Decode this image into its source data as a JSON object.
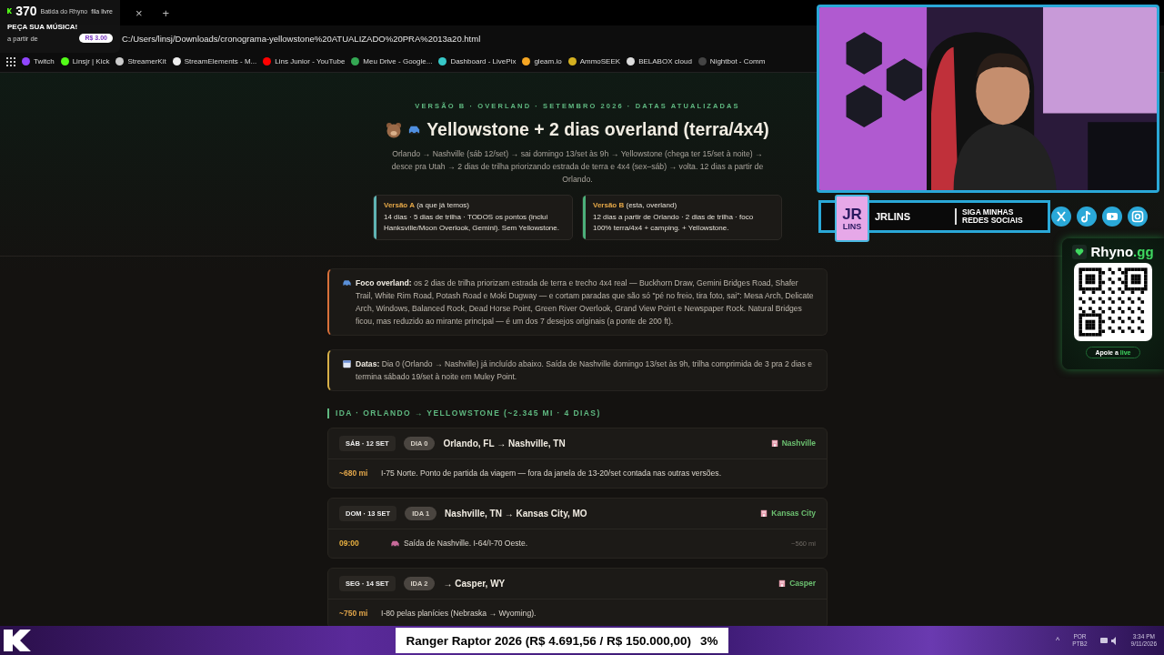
{
  "stream_overlay": {
    "viewer_count": "370",
    "request_widget": {
      "channel": "Batida do Rhyno",
      "tag": "fila livre",
      "title": "PEÇA SUA MÚSICA!",
      "price_label": "a partir de",
      "price": "R$ 3.00"
    }
  },
  "browser": {
    "tab_close": "×",
    "new_tab": "+",
    "url": "C:/Users/linsj/Downloads/cronograma-yellowstone%20ATUALIZADO%20PRA%2013a20.html",
    "bookmarks": [
      {
        "label": "Twitch",
        "color": "#9146ff"
      },
      {
        "label": "Linsjr | Kick",
        "color": "#53fc18"
      },
      {
        "label": "StreamerKit",
        "color": "#cccccc"
      },
      {
        "label": "StreamElements - M...",
        "color": "#eeeeee"
      },
      {
        "label": "Lins Junior - YouTube",
        "color": "#ff0000"
      },
      {
        "label": "Meu Drive - Google...",
        "color": "#34a853"
      },
      {
        "label": "Dashboard - LivePix",
        "color": "#37c8c8"
      },
      {
        "label": "gleam.io",
        "color": "#f5a623"
      },
      {
        "label": "AmmoSEEK",
        "color": "#d4b020"
      },
      {
        "label": "BELABOX cloud",
        "color": "#dddddd"
      },
      {
        "label": "Nightbot - Comm",
        "color": "#444444"
      }
    ]
  },
  "page": {
    "kicker": "VERSÃO B · OVERLAND · SETEMBRO 2026 · DATAS ATUALIZADAS",
    "title": "Yellowstone + 2 dias overland (terra/4x4)",
    "subtitle": "Orlando → Nashville (sáb 12/set) → sai domingo 13/set às 9h → Yellowstone (chega ter 15/set à noite) → desce pra Utah → 2 dias de trilha priorizando estrada de terra e 4x4 (sex–sáb) → volta. 12 dias a partir de Orlando.",
    "versions": [
      {
        "name": "Versão A",
        "note": "(a que já temos)",
        "description": "14 dias · 5 dias de trilha · TODOS os pontos (inclui Hanksville/Moon Overlook, Gemini). Sem Yellowstone.",
        "color": "#5fb3b3"
      },
      {
        "name": "Versão B",
        "note": "(esta, overland)",
        "description": "12 dias a partir de Orlando · 2 dias de trilha · foco 100% terra/4x4 + camping. + Yellowstone.",
        "color": "#4caf7a"
      }
    ],
    "callouts": [
      {
        "kind": "focus",
        "text": "**Foco overland:** os 2 dias de trilha priorizam estrada de terra e trecho 4x4 real — Buckhorn Draw, Gemini Bridges Road, Shafer Trail, White Rim Road, Potash Road e Moki Dugway — e cortam paradas que são só \"pé no freio, tira foto, sai\": Mesa Arch, Delicate Arch, Windows, Balanced Rock, Dead Horse Point, Green River Overlook, Grand View Point e Newspaper Rock. Natural Bridges ficou, mas reduzido ao mirante principal — é um dos 7 desejos originais (a ponte de 200 ft)."
      },
      {
        "kind": "dates",
        "text": "**Datas:** Dia 0 (Orlando → Nashville) já incluído abaixo. Saída de Nashville domingo 13/set às 9h, trilha comprimida de 3 pra 2 dias e termina sábado 19/set à noite em Muley Point."
      }
    ],
    "section_title": "IDA · ORLANDO → YELLOWSTONE (~2.345 MI · 4 DIAS)",
    "days": [
      {
        "date": "SÁB · 12 SET",
        "badge": "DIA 0",
        "route": "Orlando, FL → Nashville, TN",
        "lodging": "Nashville",
        "entries": [
          {
            "kind": "distance",
            "lead": "~680 mi",
            "icon": false,
            "text": "I-75 Norte. Ponto de partida da viagem — fora da janela de 13-20/set contada nas outras versões."
          }
        ]
      },
      {
        "date": "DOM · 13 SET",
        "badge": "IDA 1",
        "route": "Nashville, TN → Kansas City, MO",
        "lodging": "Kansas City",
        "entries": [
          {
            "kind": "time",
            "lead": "09:00",
            "icon": true,
            "text": "Saída de Nashville. I-64/I-70 Oeste.",
            "distance": "~560 mi"
          }
        ]
      },
      {
        "date": "SEG · 14 SET",
        "badge": "IDA 2",
        "route": "→ Casper, WY",
        "lodging": "Casper",
        "entries": [
          {
            "kind": "distance",
            "lead": "~750 mi",
            "icon": false,
            "text": "I-80 pelas planícies (Nebraska → Wyoming)."
          }
        ]
      }
    ]
  },
  "social_banner": {
    "logo_top": "JR",
    "logo_bottom": "LINS",
    "channel": "JRLINS",
    "call_to_action": "SIGA MINHAS REDES SOCIAIS"
  },
  "donation_widget": {
    "brand": "Rhyno",
    "brand_suffix": ".gg",
    "button_label": "Apoie a",
    "button_highlight": "live"
  },
  "goal_bar": {
    "text": "Ranger Raptor 2026 (R$ 4.691,56 / R$ 150.000,00)",
    "percent": "3%"
  },
  "taskbar": {
    "caret": "^",
    "language": "POR",
    "layout": "PTB2",
    "time": "3:34 PM",
    "date": "9/11/2026"
  }
}
